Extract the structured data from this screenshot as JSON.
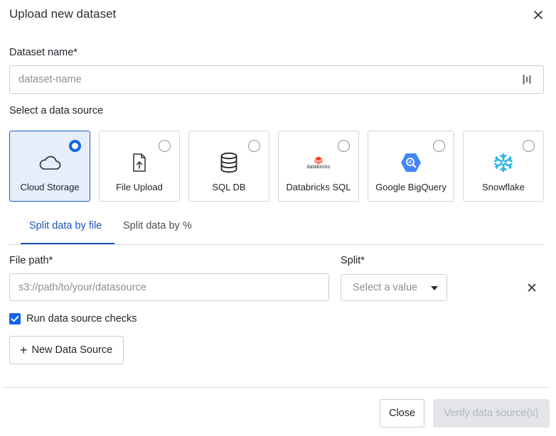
{
  "dialog": {
    "title": "Upload new dataset"
  },
  "dataset_name": {
    "label": "Dataset name*",
    "placeholder": "dataset-name",
    "value": ""
  },
  "data_source": {
    "label": "Select a data source",
    "selected": "Cloud Storage",
    "options": [
      {
        "label": "Cloud Storage",
        "icon": "cloud-icon"
      },
      {
        "label": "File Upload",
        "icon": "file-upload-icon"
      },
      {
        "label": "SQL DB",
        "icon": "database-icon"
      },
      {
        "label": "Databricks SQL",
        "icon": "databricks-logo"
      },
      {
        "label": "Google BigQuery",
        "icon": "bigquery-logo"
      },
      {
        "label": "Snowflake",
        "icon": "snowflake-logo"
      }
    ],
    "databricks_logo_text": "databricks"
  },
  "tabs": [
    {
      "label": "Split data by file",
      "active": true
    },
    {
      "label": "Split data by %",
      "active": false
    }
  ],
  "file_path": {
    "label": "File path*",
    "placeholder": "s3://path/to/your/datasource",
    "value": ""
  },
  "split": {
    "label": "Split*",
    "placeholder": "Select a value"
  },
  "checks": {
    "label": "Run data source checks",
    "checked": true
  },
  "new_source_button": {
    "label": "New Data Source"
  },
  "footer": {
    "close_label": "Close",
    "verify_label": "Verify data source(s)"
  },
  "colors": {
    "accent": "#1463ea",
    "tab_active": "#1a56b8",
    "selected_card_bg": "#e6eefb",
    "databricks": "#ff3621",
    "bigquery": "#4386fa",
    "snowflake": "#29b5e8"
  }
}
